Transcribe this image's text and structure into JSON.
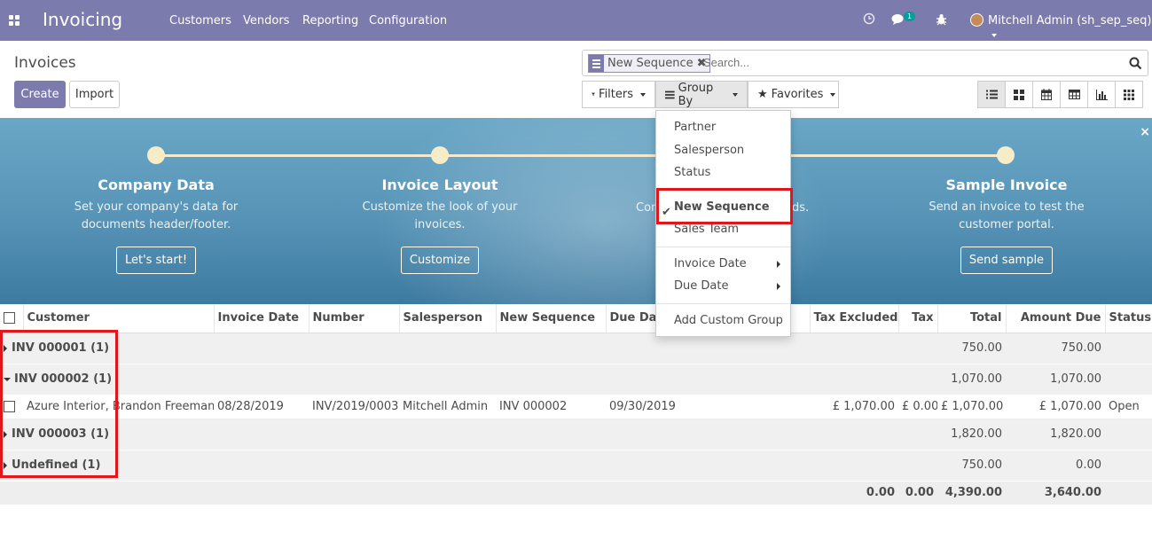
{
  "navbar": {
    "app_title": "Invoicing",
    "menu": [
      "Customers",
      "Vendors",
      "Reporting",
      "Configuration"
    ],
    "chat_badge": "1",
    "user": "Mitchell Admin (sh_sep_seq)"
  },
  "control": {
    "title": "Invoices",
    "create_label": "Create",
    "import_label": "Import",
    "facet_label": "New Sequence",
    "facet_remove": "✖",
    "search_placeholder": "Search...",
    "filters_label": "Filters",
    "groupby_label": "Group By",
    "favorites_label": "Favorites",
    "views": [
      "list-icon",
      "kanban-icon",
      "calendar-icon",
      "pivot-icon",
      "graph-icon",
      "grid-icon"
    ]
  },
  "banner": {
    "steps": [
      {
        "title": "Company Data",
        "desc1": "Set your company's data for",
        "desc2": "documents header/footer.",
        "button": "Let's start!"
      },
      {
        "title": "Invoice Layout",
        "desc1": "Customize the look of your",
        "desc2": "invoices.",
        "button": "Customize"
      },
      {
        "title": "",
        "desc1": "Con",
        "desc2": "",
        "tail": "ds.",
        "button": ""
      },
      {
        "title": "Sample Invoice",
        "desc1": "Send an invoice to test the",
        "desc2": "customer portal.",
        "button": "Send sample"
      }
    ],
    "close": "×"
  },
  "groupby_menu": {
    "items": [
      "Partner",
      "Salesperson",
      "Status",
      "New Sequence",
      "Sales Team",
      "Invoice Date",
      "Due Date",
      "Add Custom Group"
    ],
    "check": "✔"
  },
  "table": {
    "columns": [
      "Customer",
      "Invoice Date",
      "Number",
      "Salesperson",
      "New Sequence",
      "Due Date",
      "",
      "Tax Excluded",
      "Tax",
      "Total",
      "Amount Due",
      "Status"
    ],
    "groups": [
      {
        "name": "INV 000001 (1)",
        "total": "750.00",
        "due": "750.00",
        "open": false
      },
      {
        "name": "INV 000002 (1)",
        "total": "1,070.00",
        "due": "1,070.00",
        "open": true
      },
      {
        "name": "INV 000003 (1)",
        "total": "1,820.00",
        "due": "1,820.00",
        "open": false
      },
      {
        "name": "Undefined (1)",
        "total": "750.00",
        "due": "0.00",
        "open": false
      }
    ],
    "row": {
      "customer": "Azure Interior, Brandon Freeman",
      "invoice_date": "08/28/2019",
      "number": "INV/2019/0003",
      "salesperson": "Mitchell Admin",
      "new_sequence": "INV 000002",
      "due_date": "09/30/2019",
      "tax_excluded": "£ 1,070.00",
      "tax": "£ 0.00",
      "total": "£ 1,070.00",
      "amount_due": "£ 1,070.00",
      "status": "Open"
    },
    "totals": {
      "tax_excluded": "0.00",
      "tax": "0.00",
      "total": "4,390.00",
      "amount_due": "3,640.00"
    }
  },
  "colors": {
    "brand": "#7c7bad",
    "highlight": "#e0161b",
    "banner": "#5693b6"
  }
}
